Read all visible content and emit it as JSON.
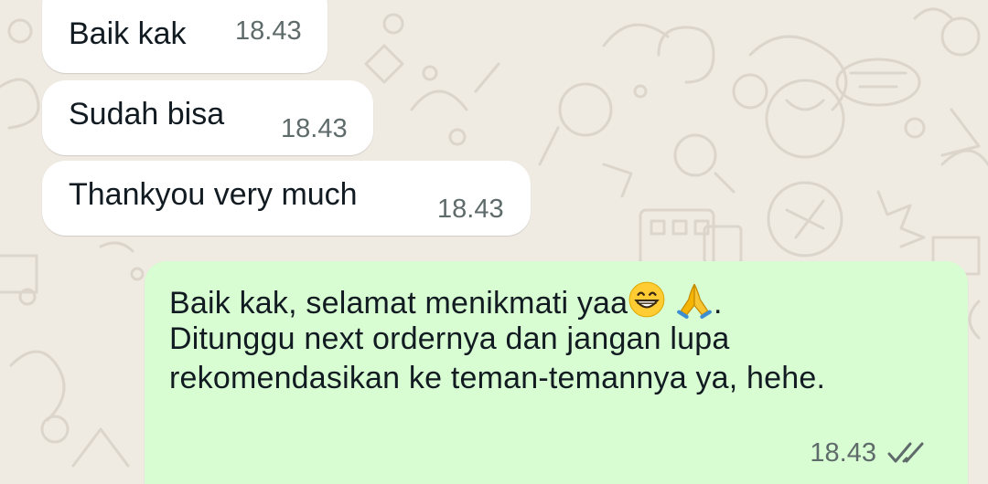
{
  "chat": {
    "messages": [
      {
        "direction": "incoming",
        "text": "Baik kak",
        "time": "18.43"
      },
      {
        "direction": "incoming",
        "text": "Sudah bisa",
        "time": "18.43"
      },
      {
        "direction": "incoming",
        "text": "Thankyou very much",
        "time": "18.43"
      },
      {
        "direction": "outgoing",
        "lines": {
          "line1_before": "Baik kak, selamat menikmati yaa",
          "line1_after": ".",
          "line2": "Ditunggu next ordernya dan jangan lupa",
          "line3": "rekomendasikan ke teman-temannya ya, hehe."
        },
        "emojis": [
          "grinning-face-emoji",
          "folded-hands-emoji"
        ],
        "time": "18.43",
        "status": "read"
      }
    ]
  },
  "colors": {
    "wallpaper": "#efeae2",
    "incoming_bubble": "#ffffff",
    "outgoing_bubble": "#d9fdd3",
    "read_ticks": "#5f6b6b"
  }
}
